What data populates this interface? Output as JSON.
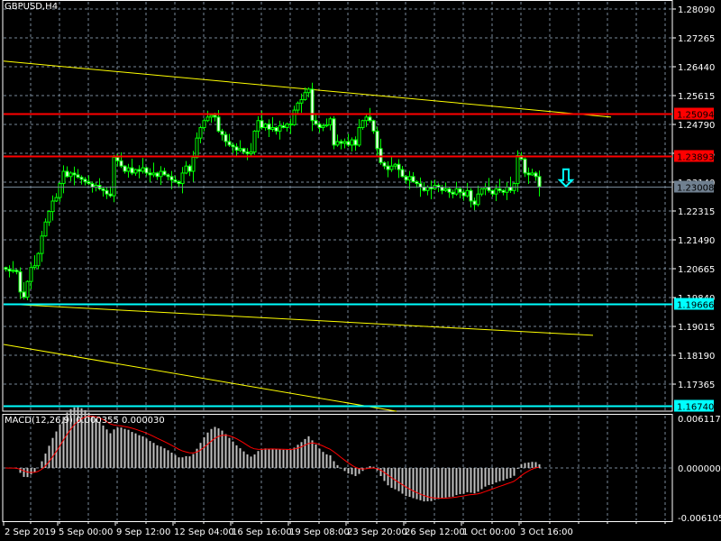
{
  "header": {
    "symbol_timeframe": "GBPUSD,H4"
  },
  "macd_header": {
    "label": "MACD(12,26,9)",
    "main": "0.000355",
    "signal": "0.000030"
  },
  "colors": {
    "background": "#000000",
    "grid": "#778899",
    "bull_outline": "#00ff00",
    "bear_fill": "#ffffff",
    "bull_fill": "#000000",
    "trendline": "#ffff00",
    "resistance": "#ff0000",
    "support": "#00ffff",
    "bid": "#778899",
    "macd_hist": "#c0c0c0",
    "macd_signal": "#ff0000"
  },
  "chart_data": {
    "type": "candlestick",
    "title": "GBPUSD,H4",
    "price_axis": {
      "ylim": [
        1.1654,
        1.2835
      ],
      "ticks": [
        "1.28090",
        "1.27265",
        "1.26440",
        "1.25615",
        "1.24790",
        "1.23965",
        "1.23140",
        "1.22315",
        "1.21490",
        "1.20665",
        "1.19840",
        "1.19015",
        "1.18190",
        "1.17365"
      ]
    },
    "time_axis": {
      "ticks": [
        {
          "label": "2 Sep 2019",
          "bar": 0
        },
        {
          "label": "5 Sep 00:00",
          "bar": 15
        },
        {
          "label": "9 Sep 12:00",
          "bar": 31
        },
        {
          "label": "12 Sep 04:00",
          "bar": 47
        },
        {
          "label": "16 Sep 16:00",
          "bar": 63
        },
        {
          "label": "19 Sep 08:00",
          "bar": 79
        },
        {
          "label": "23 Sep 20:00",
          "bar": 95
        },
        {
          "label": "26 Sep 12:00",
          "bar": 111
        },
        {
          "label": "1 Oct 00:00",
          "bar": 127
        },
        {
          "label": "3 Oct 16:00",
          "bar": 143
        }
      ]
    },
    "closes": [
      1.2065,
      1.206,
      1.2062,
      1.2058,
      1.2,
      1.1985,
      1.203,
      1.207,
      1.2075,
      1.211,
      1.216,
      1.22,
      1.223,
      1.226,
      1.227,
      1.231,
      1.2345,
      1.233,
      1.234,
      1.2335,
      1.2328,
      1.2322,
      1.2315,
      1.231,
      1.23,
      1.2305,
      1.2295,
      1.229,
      1.228,
      1.2275,
      1.2385,
      1.2375,
      1.236,
      1.2345,
      1.2355,
      1.234,
      1.235,
      1.2345,
      1.2355,
      1.234,
      1.2335,
      1.234,
      1.233,
      1.2345,
      1.2335,
      1.233,
      1.232,
      1.2315,
      1.231,
      1.234,
      1.236,
      1.2345,
      1.2385,
      1.244,
      1.247,
      1.249,
      1.25,
      1.2505,
      1.25,
      1.246,
      1.245,
      1.243,
      1.242,
      1.2415,
      1.2405,
      1.241,
      1.24,
      1.2395,
      1.24,
      1.246,
      1.249,
      1.247,
      1.248,
      1.2465,
      1.247,
      1.246,
      1.2475,
      1.247,
      1.248,
      1.2478,
      1.252,
      1.254,
      1.255,
      1.257,
      1.258,
      1.249,
      1.248,
      1.247,
      1.2475,
      1.2478,
      1.2495,
      1.242,
      1.243,
      1.2425,
      1.243,
      1.242,
      1.2435,
      1.242,
      1.247,
      1.249,
      1.25,
      1.249,
      1.246,
      1.241,
      1.237,
      1.236,
      1.235,
      1.236,
      1.2365,
      1.235,
      1.233,
      1.232,
      1.233,
      1.2315,
      1.231,
      1.23,
      1.229,
      1.23,
      1.2295,
      1.2305,
      1.23,
      1.229,
      1.2295,
      1.2285,
      1.228,
      1.2295,
      1.2285,
      1.2275,
      1.229,
      1.226,
      1.225,
      1.228,
      1.2295,
      1.23,
      1.229,
      1.228,
      1.2295,
      1.229,
      1.2285,
      1.23,
      1.229,
      1.231,
      1.239,
      1.238,
      1.234,
      1.2335,
      1.234,
      1.233,
      1.2301
    ],
    "first_open": 1.207,
    "horizontal_levels": [
      {
        "price": 1.25094,
        "label": "1.25094",
        "kind": "resistance"
      },
      {
        "price": 1.23893,
        "label": "1.23893",
        "kind": "resistance"
      },
      {
        "price": 1.23008,
        "label": "1.23008",
        "kind": "bid"
      },
      {
        "price": 1.19666,
        "label": "1.19666",
        "kind": "support"
      },
      {
        "price": 1.1674,
        "label": "1.16740",
        "kind": "support"
      }
    ],
    "trendlines": [
      {
        "from": {
          "bar": -0.5,
          "price": 1.266
        },
        "to": {
          "bar": 168,
          "price": 1.25
        }
      },
      {
        "from": {
          "bar": -0.5,
          "price": 1.1966
        },
        "to": {
          "bar": 163,
          "price": 1.1876
        }
      },
      {
        "from": {
          "bar": -0.5,
          "price": 1.185
        },
        "to": {
          "bar": 108.5,
          "price": 1.1659
        }
      }
    ],
    "signal_arrow": {
      "direction": "down",
      "bar": 155.5,
      "price": 1.2325
    },
    "macd": {
      "fast": 12,
      "slow": 26,
      "signal": 9,
      "ylim": [
        -0.006105,
        0.006117
      ],
      "ticks": [
        "0.006117",
        "0.000000",
        "-0.006105"
      ]
    }
  }
}
